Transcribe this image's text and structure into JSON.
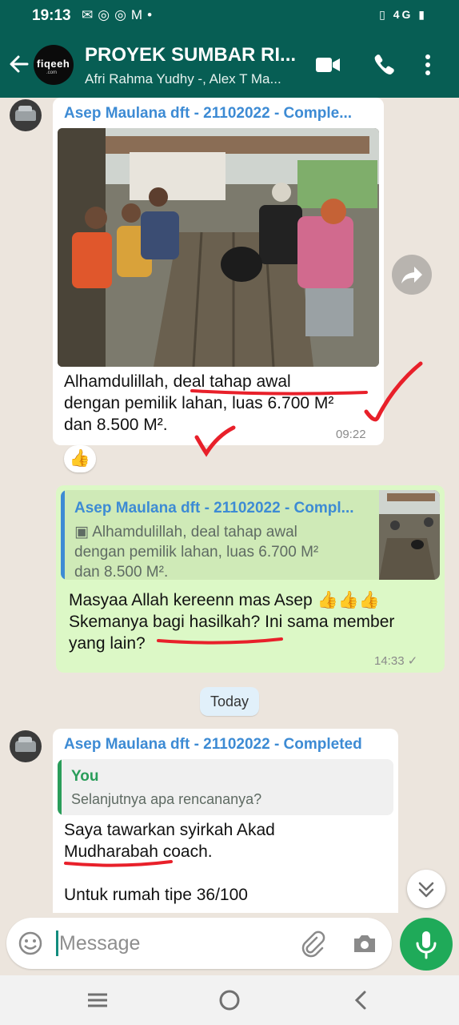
{
  "status_bar": {
    "time": "19:13",
    "left_icons": [
      "message-icon",
      "instagram-icon",
      "instagram-icon",
      "gmail-icon",
      "dot-icon"
    ],
    "network": "4G"
  },
  "header": {
    "title": "PROYEK SUMBAR RI...",
    "subtitle": "Afri Rahma Yudhy -, Alex T Ma...",
    "avatar_text": "fiqeeh",
    "avatar_sub": ".com"
  },
  "messages": [
    {
      "sender": "Asep Maulana dft - 21102022 - Comple...",
      "text_lines": [
        "Alhamdulillah, deal tahap awal",
        "dengan pemilik lahan, luas 6.700 M²",
        "dan 8.500 M²."
      ],
      "time": "09:22",
      "reaction": "👍"
    },
    {
      "quote_sender": "Asep Maulana dft - 21102022 - Compl...",
      "quote_lines": [
        "Alhamdulillah, deal tahap awal",
        "dengan pemilik lahan, luas 6.700 M²",
        "dan 8.500 M²."
      ],
      "text_lines": [
        "Masyaa Allah kereenn mas Asep 👍👍👍",
        "Skemanya bagi hasilkah? Ini sama member",
        "yang lain?"
      ],
      "time": "14:33"
    },
    {
      "sender": "Asep Maulana dft - 21102022 - Completed",
      "quote_sender": "You",
      "quote_text": "Selanjutnya apa rencananya?",
      "text_lines": [
        "Saya tawarkan syirkah Akad",
        "Mudharabah coach.",
        "",
        "Untuk rumah tipe 36/100"
      ]
    }
  ],
  "date_chip": "Today",
  "composer": {
    "placeholder": "Message"
  },
  "colors": {
    "header": "#075e54",
    "chat_bg": "#ece5dd",
    "outgoing_bubble": "#dcf8c6",
    "sender_name": "#3d8bd4",
    "you_name": "#2a9d5a",
    "mic_button": "#1faa59",
    "annotation": "#e8202a"
  }
}
